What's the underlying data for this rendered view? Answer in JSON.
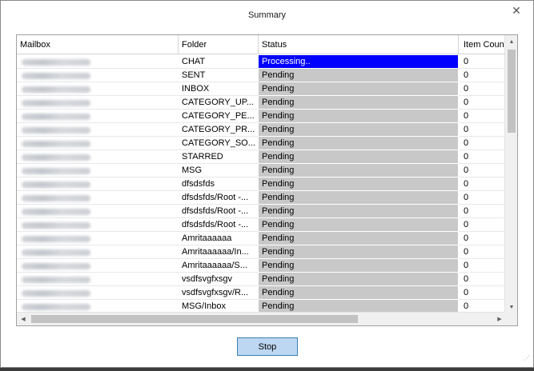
{
  "window": {
    "title": "Summary",
    "close_glyph": "✕"
  },
  "table": {
    "columns": {
      "mailbox": "Mailbox",
      "folder": "Folder",
      "status": "Status",
      "count": "Item Count"
    },
    "rows": [
      {
        "folder": "CHAT",
        "status": "Processing..",
        "count": "0",
        "active": true
      },
      {
        "folder": "SENT",
        "status": "Pending",
        "count": "0"
      },
      {
        "folder": "INBOX",
        "status": "Pending",
        "count": "0"
      },
      {
        "folder": "CATEGORY_UP...",
        "status": "Pending",
        "count": "0"
      },
      {
        "folder": "CATEGORY_PE...",
        "status": "Pending",
        "count": "0"
      },
      {
        "folder": "CATEGORY_PR...",
        "status": "Pending",
        "count": "0"
      },
      {
        "folder": "CATEGORY_SO...",
        "status": "Pending",
        "count": "0"
      },
      {
        "folder": "STARRED",
        "status": "Pending",
        "count": "0"
      },
      {
        "folder": "MSG",
        "status": "Pending",
        "count": "0"
      },
      {
        "folder": "dfsdsfds",
        "status": "Pending",
        "count": "0"
      },
      {
        "folder": "dfsdsfds/Root -...",
        "status": "Pending",
        "count": "0"
      },
      {
        "folder": "dfsdsfds/Root -...",
        "status": "Pending",
        "count": "0"
      },
      {
        "folder": "dfsdsfds/Root -...",
        "status": "Pending",
        "count": "0"
      },
      {
        "folder": "Amritaaaaaa",
        "status": "Pending",
        "count": "0"
      },
      {
        "folder": "Amritaaaaaa/In...",
        "status": "Pending",
        "count": "0"
      },
      {
        "folder": "Amritaaaaaa/S...",
        "status": "Pending",
        "count": "0"
      },
      {
        "folder": "vsdfsvgfxsgv",
        "status": "Pending",
        "count": "0"
      },
      {
        "folder": "vsdfsvgfxsgv/R...",
        "status": "Pending",
        "count": "0"
      },
      {
        "folder": "MSG/Inbox",
        "status": "Pending",
        "count": "0"
      }
    ]
  },
  "actions": {
    "stop_label": "Stop"
  },
  "colors": {
    "processing": "#0000ff",
    "pending": "#c8c8c8",
    "button_bg": "#bdd7f2",
    "button_border": "#3c7fb1"
  }
}
